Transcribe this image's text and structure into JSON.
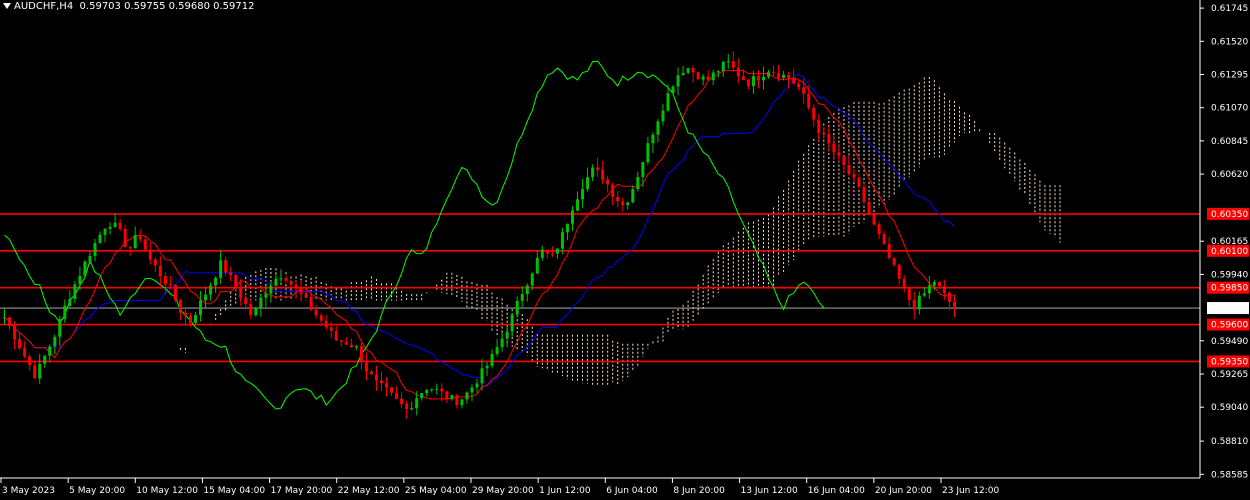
{
  "window": {
    "symbol_label": "AUDCHF,H4",
    "ohlc": "0.59703 0.59755 0.59680 0.59712"
  },
  "colors": {
    "background": "#000000",
    "bull_candle": "#00c000",
    "bear_candle": "#ff0000",
    "tenkan": "#ff0000",
    "kijun": "#0000ff",
    "chikou": "#00ff00",
    "cloud_hatch": "#ffe4c4",
    "level_line": "#ff0000",
    "level_label_bg": "#ff0000",
    "current_price_label_bg": "#ffffff"
  },
  "chart_data": {
    "type": "candlestick",
    "title": "AUDCHF,H4",
    "indicators": [
      "Ichimoku Kinko Hyo"
    ],
    "price_axis_ticks": [
      "0.61745",
      "0.61520",
      "0.61295",
      "0.61070",
      "0.60845",
      "0.60620",
      "0.60165",
      "0.59940",
      "0.59490",
      "0.59265",
      "0.59040",
      "0.58810",
      "0.58585"
    ],
    "time_axis_ticks": [
      "3 May 2023",
      "5 May 20:00",
      "10 May 12:00",
      "15 May 04:00",
      "17 May 20:00",
      "22 May 12:00",
      "25 May 04:00",
      "29 May 20:00",
      "1 Jun 12:00",
      "6 Jun 04:00",
      "8 Jun 20:00",
      "13 Jun 12:00",
      "16 Jun 04:00",
      "20 Jun 20:00",
      "23 Jun 12:00"
    ],
    "ylim": [
      0.5856,
      0.618
    ],
    "horizontal_levels": [
      "0.60350",
      "0.60100",
      "0.59850",
      "0.59600",
      "0.59350"
    ],
    "current_price": "0.59712",
    "close_path": [
      0.5965,
      0.5952,
      0.5938,
      0.5925,
      0.594,
      0.5955,
      0.5975,
      0.599,
      0.6005,
      0.6018,
      0.603,
      0.6025,
      0.601,
      0.6022,
      0.6005,
      0.5995,
      0.5985,
      0.597,
      0.5962,
      0.5975,
      0.5988,
      0.6002,
      0.599,
      0.5978,
      0.5965,
      0.598,
      0.599,
      0.5995,
      0.5985,
      0.5978,
      0.5968,
      0.596,
      0.595,
      0.5948,
      0.5945,
      0.593,
      0.592,
      0.5915,
      0.5908,
      0.5902,
      0.5912,
      0.5918,
      0.5915,
      0.591,
      0.5908,
      0.5915,
      0.5925,
      0.5935,
      0.5948,
      0.5962,
      0.598,
      0.5995,
      0.601,
      0.6005,
      0.602,
      0.604,
      0.6055,
      0.6065,
      0.606,
      0.6048,
      0.604,
      0.6055,
      0.6075,
      0.6095,
      0.6112,
      0.6128,
      0.6135,
      0.613,
      0.6125,
      0.6132,
      0.6138,
      0.613,
      0.6124,
      0.6128,
      0.6133,
      0.613,
      0.6127,
      0.612,
      0.6105,
      0.609,
      0.608,
      0.607,
      0.606,
      0.6048,
      0.603,
      0.6015,
      0.6,
      0.5985,
      0.5972,
      0.598,
      0.599,
      0.598,
      0.5971
    ]
  }
}
